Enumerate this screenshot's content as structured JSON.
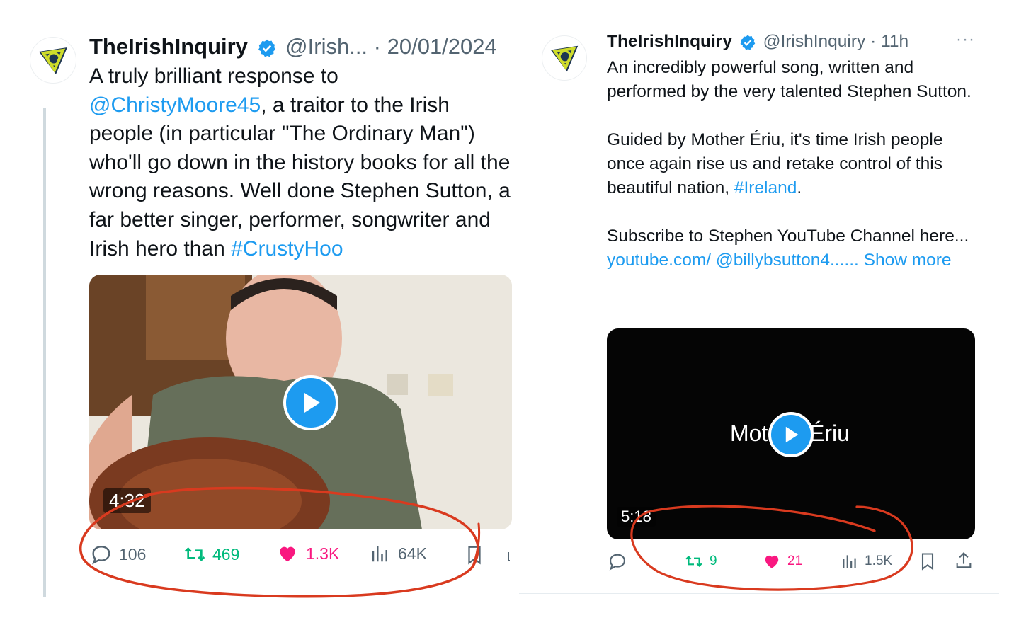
{
  "left": {
    "name": "TheIrishInquiry",
    "handle": "@Irish...",
    "date": "· 20/01/2024",
    "text_intro": "A truly brilliant response to ",
    "mention": "@ChristyMoore45",
    "text_body": ", a traitor to the Irish people (in particular \"The Ordinary Man\") who'll go down in the history books for all the wrong reasons. Well done Stephen Sutton, a far better singer, performer, songwriter and Irish hero than ",
    "hashtag": "#CrustyHoo",
    "video_duration": "4:32",
    "replies": "106",
    "reposts": "469",
    "likes": "1.3K",
    "views": "64K"
  },
  "right": {
    "name": "TheIrishInquiry",
    "handle": "@IrishInquiry",
    "time": "· 11h",
    "more": "···",
    "p1": "An incredibly powerful song, written and performed by the very talented Stephen Sutton.",
    "p2_text": "Guided by Mother Ériu, it's time Irish people once again rise us and retake control of this beautiful nation, ",
    "p2_hashtag": "#Ireland",
    "p2_end": ".",
    "p3_text": "Subscribe to Stephen YouTube Channel here... ",
    "p3_link": "youtube.com/ @billybsutton4...",
    "p3_ellipsis": "...",
    "show_more": " Show more",
    "video_title_left": "Mot",
    "video_title_right": "Ériu",
    "video_duration": "5:18",
    "reposts": "9",
    "likes": "21",
    "views": "1.5K"
  },
  "colors": {
    "link": "#1d9bf0",
    "repost": "#00ba7c",
    "like": "#f91880",
    "annotation": "#d93a1f"
  }
}
